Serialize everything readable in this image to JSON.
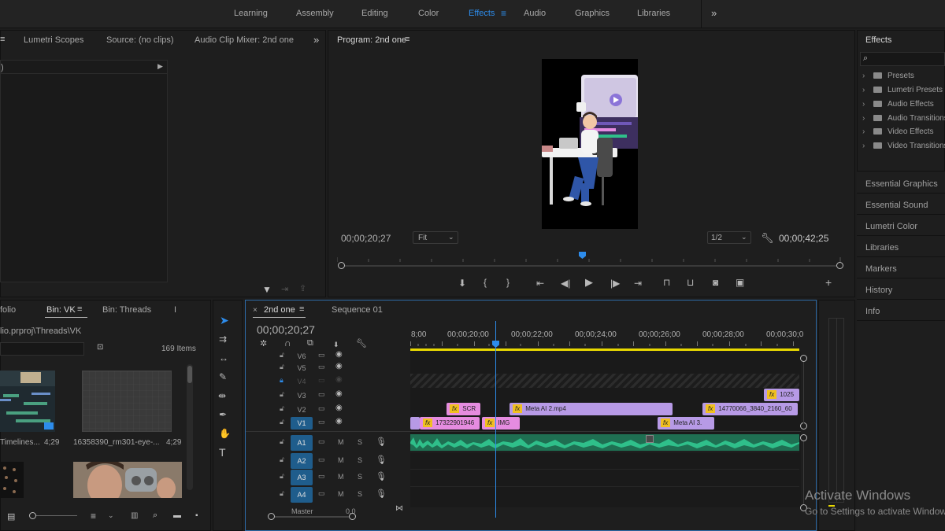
{
  "workspaces": [
    "Learning",
    "Assembly",
    "Editing",
    "Color",
    "Effects",
    "Audio",
    "Graphics",
    "Libraries"
  ],
  "active_workspace": "Effects",
  "more_icon": "double-chevron-right-icon",
  "source_panel": {
    "tabs": [
      "Lumetri Scopes",
      "Source: (no clips)",
      "Audio Clip Mixer: 2nd one"
    ],
    "collapsed_left_text": ")"
  },
  "program": {
    "title": "Program: 2nd one",
    "timecode": "00;00;20;27",
    "fit": "Fit",
    "resolution": "1/2",
    "duration": "00;00;42;25"
  },
  "project": {
    "tabs": [
      "folio",
      "Bin: VK",
      "Bin: Threads"
    ],
    "path": "lio.prproj\\Threads\\VK",
    "items_count": "169 Items",
    "thumbs": [
      {
        "name": "Timelines...",
        "dur": "4;29"
      },
      {
        "name": "16358390_rm301-eye-...",
        "dur": "4;29"
      }
    ]
  },
  "timeline": {
    "tabs": [
      "2nd one",
      "Sequence 01"
    ],
    "timecode": "00;00;20;27",
    "ruler": [
      "8;00",
      "00;00;20;00",
      "00;00;22;00",
      "00;00;24;00",
      "00;00;26;00",
      "00;00;28;00",
      "00;00;30;0"
    ],
    "video_tracks": [
      "V6",
      "V5",
      "V4",
      "V3",
      "V2",
      "V1"
    ],
    "audio_tracks": [
      "A1",
      "A2",
      "A3",
      "A4"
    ],
    "master": "Master",
    "master_val": "0.0",
    "mute": "M",
    "solo": "S",
    "clips": {
      "v3": "1025",
      "v2a": "SCR",
      "v2b": "Meta AI  2.mp4",
      "v2c": "14770066_3840_2160_60",
      "v1a": "17322901946",
      "v1b": "IMG",
      "v1c": "Meta AI  3."
    },
    "fx": "fx"
  },
  "effects": {
    "title": "Effects",
    "items": [
      "Presets",
      "Lumetri Presets",
      "Audio Effects",
      "Audio Transitions",
      "Video Effects",
      "Video Transitions"
    ]
  },
  "side_panels": [
    "Essential Graphics",
    "Essential Sound",
    "Lumetri Color",
    "Libraries",
    "Markers",
    "History",
    "Info"
  ],
  "watermark": {
    "title": "Activate Windows",
    "sub": "Go to Settings to activate Windows."
  },
  "colors": {
    "accent": "#2d8ceb",
    "clip_pink": "#e58ce0",
    "clip_purple": "#b79ae6",
    "audio": "#2fbf8a",
    "fx_badge": "#f0c020"
  }
}
